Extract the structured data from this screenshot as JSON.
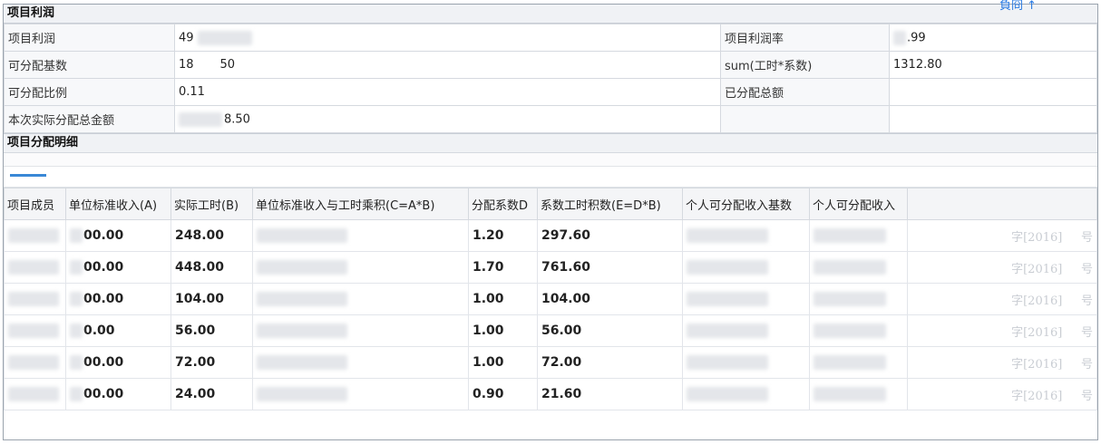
{
  "top_link": "負冏 ↑",
  "summary": {
    "title": "项目利润",
    "rows": [
      {
        "l1": "项目利润",
        "v1": "49",
        "l2": "项目利润率",
        "v2": ".99"
      },
      {
        "l1": "可分配基数",
        "v1": "18       50",
        "l2": "sum(工时*系数)",
        "v2": "1312.80"
      },
      {
        "l1": "可分配比例",
        "v1": "0.11",
        "l2": "已分配总额",
        "v2": ""
      },
      {
        "l1": "本次实际分配总金额",
        "v1": "8.50",
        "l2": "",
        "v2": ""
      }
    ]
  },
  "detail": {
    "title": "项目分配明细",
    "columns": [
      "项目成员",
      "单位标准收入(A)",
      "实际工时(B)",
      "单位标准收入与工时乘积(C=A*B)",
      "分配系数D",
      "系数工时积数(E=D*B)",
      "个人可分配收入基数",
      "个人可分配收入",
      ""
    ],
    "rows": [
      {
        "a": "00.00",
        "b": "248.00",
        "d": "1.20",
        "e": "297.60",
        "wm": "字[2016]     号"
      },
      {
        "a": "00.00",
        "b": "448.00",
        "d": "1.70",
        "e": "761.60",
        "wm": "字[2016]     号"
      },
      {
        "a": "00.00",
        "b": "104.00",
        "d": "1.00",
        "e": "104.00",
        "wm": "字[2016]     号"
      },
      {
        "a": "0.00",
        "b": "56.00",
        "d": "1.00",
        "e": "56.00",
        "wm": "字[2016]     号"
      },
      {
        "a": "00.00",
        "b": "72.00",
        "d": "1.00",
        "e": "72.00",
        "wm": "字[2016]     号"
      },
      {
        "a": "00.00",
        "b": "24.00",
        "d": "0.90",
        "e": "21.60",
        "wm": "字[2016]     号"
      }
    ]
  }
}
